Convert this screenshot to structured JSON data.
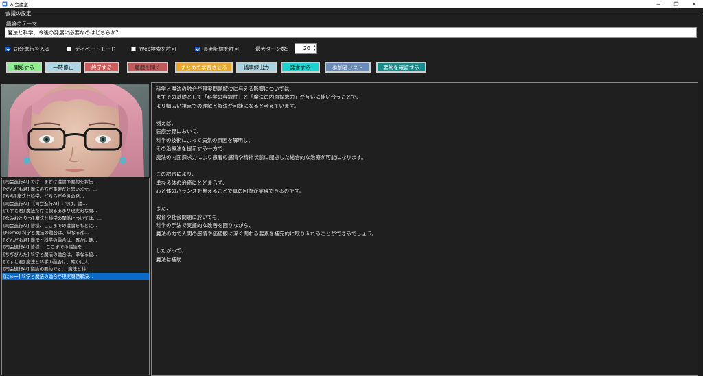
{
  "window": {
    "title": "AI会議室",
    "minimize": "─",
    "restore": "❐",
    "close": "✕",
    "icon": "app-icon"
  },
  "settings": {
    "group_title": "会議の設定",
    "theme_label": "議論のテーマ:",
    "theme_value": "魔法と科学、今後の発展に必要なのはどちらか？",
    "options": [
      {
        "label": "司会進行を入る",
        "checked": true
      },
      {
        "label": "ディベートモード",
        "checked": false
      },
      {
        "label": "Web検索を許可",
        "checked": false
      },
      {
        "label": "長期記憶を許可",
        "checked": true
      }
    ],
    "max_turns_label": "最大ターン数:",
    "max_turns_value": "20"
  },
  "buttons": [
    {
      "label": "開始する",
      "bg": "#90ee90",
      "fg": "#000000"
    },
    {
      "label": "一時停止",
      "bg": "#add8e6",
      "fg": "#000000"
    },
    {
      "label": "終了する",
      "bg": "#cd5c5c",
      "fg": "#ffffff"
    },
    {
      "label": "履歴を開く",
      "bg": "#c05a5a",
      "fg": "#2a2a2a"
    },
    {
      "label": "まとめて学習させる",
      "bg": "#e8a830",
      "fg": "#ffffff"
    },
    {
      "label": "議事録出力",
      "bg": "#a9d3e0",
      "fg": "#000000"
    },
    {
      "label": "発言する",
      "bg": "#20d0d0",
      "fg": "#000000"
    },
    {
      "label": "参加者リスト",
      "bg": "#6a8cb8",
      "fg": "#ffffff"
    },
    {
      "label": "要約を確認する",
      "bg": "#1a8a8a",
      "fg": "#ffffff"
    }
  ],
  "log": [
    "[司会進行AI] では、まずは議論の要約をお伝...",
    "[ずんだも君] 魔法の方が重要だと思います。...",
    "[ちち] 魔法と科学、どちらが今後の発...",
    "[司会進行AI] 【司会進行AI】: では、議...",
    "[てすと君] 魔法だけに頼るあまり現実的な問...",
    "[なみおとりつ] 魔法と科学の関係については、...",
    "[司会進行AI] 皆様、ここまでの議論をもとに...",
    "[Momo] 科学と魔法の融合は、単なる補...",
    "[ずんだも君] 魔法と科学の融合は、確かに魅...",
    "[司会進行AI] 皆様、　ここまでの議論を...",
    "[ちぢびんた] 科学と魔法の融合は、単なる協...",
    "[てすと君] 魔法と科学の融合は、確かに人...",
    "[司会進行AI] 議論の要約です。　魔法と科...",
    "[にゅー] 科学と魔法の融合が現実問題解決..."
  ],
  "selected_log_index": 13,
  "main_text": [
    "科学と魔法の融合が現実問題解決に与える影響については、",
    "まずその基礎として「科学の客観性」と「魔法の内面探求力」が互いに補い合うことで、",
    "より幅広い視点での理解と解決が可能になると考えています。",
    "",
    "例えば、",
    "医療分野において、",
    "科学の技術によって病気の原因を解明し、",
    "その治療法を提示する一方で、",
    "魔法の内面探求力により患者の感情や精神状態に配慮した総合的な治療が可能になります。",
    "",
    "この融合により、",
    "単なる体の治癒にとどまらず、",
    "心と体のバランスを整えることで真の回復が実現できるのです。",
    "",
    "また、",
    "教育や社会問題に於いても、",
    "科学の手法で実証的な改善を図りながら、",
    "魔法の力で人間の感情や価値観に深く関わる要素を補完的に取り入れることができるでしょう。",
    "",
    "したがって、",
    "魔法は補助"
  ]
}
